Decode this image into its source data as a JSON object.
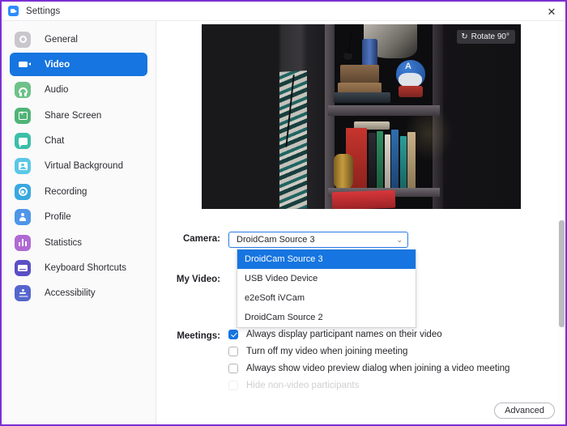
{
  "window": {
    "title": "Settings",
    "app_icon": "zoom-camera-icon",
    "close_label": "✕"
  },
  "sidebar": {
    "items": [
      {
        "label": "General",
        "icon": "gear-icon",
        "color": "#c9c7cc",
        "active": false
      },
      {
        "label": "Video",
        "icon": "video-camera-icon",
        "color": "#1675e0",
        "active": true
      },
      {
        "label": "Audio",
        "icon": "headphones-icon",
        "color": "#6ec18a",
        "active": false
      },
      {
        "label": "Share Screen",
        "icon": "share-screen-icon",
        "color": "#4fb477",
        "active": false
      },
      {
        "label": "Chat",
        "icon": "chat-bubble-icon",
        "color": "#3bbfa8",
        "active": false
      },
      {
        "label": "Virtual Background",
        "icon": "virtual-background-icon",
        "color": "#5ac8e6",
        "active": false
      },
      {
        "label": "Recording",
        "icon": "record-circle-icon",
        "color": "#38a8e0",
        "active": false
      },
      {
        "label": "Profile",
        "icon": "person-icon",
        "color": "#4f96e8",
        "active": false
      },
      {
        "label": "Statistics",
        "icon": "bar-chart-icon",
        "color": "#b06ad4",
        "active": false
      },
      {
        "label": "Keyboard Shortcuts",
        "icon": "keyboard-icon",
        "color": "#5b4fc4",
        "active": false
      },
      {
        "label": "Accessibility",
        "icon": "accessibility-icon",
        "color": "#5566cc",
        "active": false
      }
    ]
  },
  "preview": {
    "rotate_button_label": "Rotate 90°",
    "rotate_icon": "rotate-ccw-icon"
  },
  "form": {
    "camera": {
      "label": "Camera:",
      "selected": "DroidCam Source 3",
      "chevron": "⌄",
      "options": [
        {
          "label": "DroidCam Source 3",
          "selected": true
        },
        {
          "label": "USB Video Device",
          "selected": false
        },
        {
          "label": "e2eSoft iVCam",
          "selected": false
        },
        {
          "label": "DroidCam Source 2",
          "selected": false
        }
      ]
    },
    "my_video": {
      "label": "My Video:"
    },
    "meetings": {
      "label": "Meetings:",
      "checkboxes": [
        {
          "label": "Always display participant names on their video",
          "checked": true,
          "cut": false
        },
        {
          "label": "Turn off my video when joining meeting",
          "checked": false,
          "cut": false
        },
        {
          "label": "Always show video preview dialog when joining a video meeting",
          "checked": false,
          "cut": false
        },
        {
          "label": "Hide non-video participants",
          "checked": false,
          "cut": true
        }
      ]
    }
  },
  "footer": {
    "advanced_label": "Advanced"
  }
}
